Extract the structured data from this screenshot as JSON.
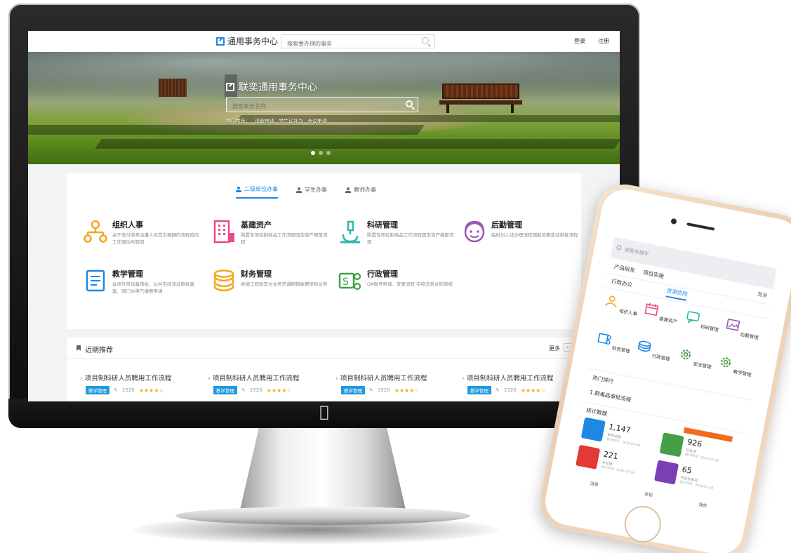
{
  "desktop": {
    "brand": "通用事务中心",
    "search_placeholder": "搜索要办理的事务",
    "login": "登录",
    "register": "注册",
    "hero": {
      "title": "联奕通用事务中心",
      "search_placeholder": "搜索事务名称",
      "hot_links": [
        "热门推荐：",
        "请假申请",
        "学生证补办",
        "会议申请"
      ]
    },
    "tabs": [
      {
        "label": "二级单位办事",
        "active": true
      },
      {
        "label": "学生办事",
        "active": false
      },
      {
        "label": "教师办事",
        "active": false
      }
    ],
    "services": [
      {
        "title": "组织人事",
        "desc": "关于支付劳务派遣人员其它报酬的流程校内工作调动与转岗"
      },
      {
        "title": "基建资产",
        "desc": "购置专项控制商品工作流程固定资产报废流程"
      },
      {
        "title": "科研管理",
        "desc": "购置专项控制商品工作流程固定资产报废流程"
      },
      {
        "title": "后勤管理",
        "desc": "临时出入证办理流程辅助设施变动审批流程"
      },
      {
        "title": "教学管理",
        "desc": "会场外带设备审批、公共空间活动审批备案、部门水电气缴费申请"
      },
      {
        "title": "财务管理",
        "desc": "修缮工程款支付业务开通网银收费项目业务"
      },
      {
        "title": "行政管理",
        "desc": "OA账号申请、变更流程 学校法务合同审核"
      }
    ],
    "recommendations": {
      "title": "近期推荐",
      "more": "更多",
      "more_arrow": "›",
      "items": [
        {
          "name": "项目制科研人员聘用工作流程",
          "badge": "教学管理",
          "views": "1520",
          "stars": "★★★★☆"
        },
        {
          "name": "项目制科研人员聘用工作流程",
          "badge": "教学管理",
          "views": "1520",
          "stars": "★★★★☆"
        },
        {
          "name": "项目制科研人员聘用工作流程",
          "badge": "教学管理",
          "views": "1520",
          "stars": "★★★★☆"
        },
        {
          "name": "项目制科研人员聘用工作流程",
          "badge": "教学管理",
          "views": "1520",
          "stars": "★★★★☆"
        }
      ]
    }
  },
  "mobile": {
    "search_placeholder": "搜索关键字",
    "tabs": [
      "产品研发",
      "项目实施"
    ],
    "login": "登录",
    "sub_tabs": [
      "行政办公",
      "资源协同"
    ],
    "grid": [
      {
        "label": "组织人事",
        "color": "#f5a623"
      },
      {
        "label": "基建资产",
        "color": "#e94b8a"
      },
      {
        "label": "科研管理",
        "color": "#2bb8a8"
      },
      {
        "label": "后勤管理",
        "color": "#9b59b6"
      },
      {
        "label": "财务管理",
        "color": "#1e88e5"
      },
      {
        "label": "行政管理",
        "color": "#1e88e5"
      },
      {
        "label": "安全管理",
        "color": "#43a047"
      },
      {
        "label": "教学管理",
        "color": "#43a047"
      }
    ],
    "hot": {
      "title": "热门排行",
      "item": "1.剧毒品审批流程"
    },
    "stats": {
      "title": "统计数据",
      "items": [
        {
          "num": "1,147",
          "label": "事务总数",
          "date": "统计时间：2016-07-08",
          "color": "#1e88e5"
        },
        {
          "num": "926",
          "label": "已处理",
          "date": "统计时间：2016-07-08",
          "color": "#43a047"
        },
        {
          "num": "221",
          "label": "未处理",
          "date": "统计时间：2016-07-08",
          "color": "#e53935"
        },
        {
          "num": "65",
          "label": "待签办事项",
          "date": "统计时间：2016-07-08",
          "color": "#7b3fb5"
        }
      ]
    },
    "bottom": [
      "消息",
      "发现",
      "我的"
    ]
  }
}
